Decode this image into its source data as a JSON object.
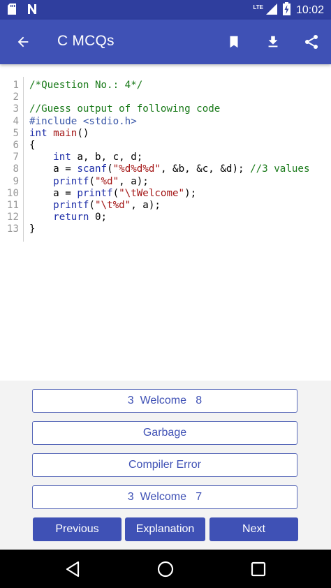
{
  "status_bar": {
    "network": "LTE",
    "time": "10:02",
    "icons": [
      "sd-card-icon",
      "n-logo-icon",
      "signal-icon",
      "battery-charging-icon"
    ]
  },
  "app_bar": {
    "title": "C MCQs",
    "icons": [
      "back-arrow-icon",
      "bookmark-icon",
      "download-icon",
      "share-icon"
    ]
  },
  "code": {
    "line_numbers": [
      "1",
      "2",
      "3",
      "4",
      "5",
      "6",
      "7",
      "8",
      "9",
      "10",
      "11",
      "12",
      "13"
    ],
    "lines": [
      [
        {
          "t": "com",
          "v": "/*Question No.: 4*/"
        }
      ],
      [],
      [
        {
          "t": "com",
          "v": "//Guess output of following code"
        }
      ],
      [
        {
          "t": "pre",
          "v": "#include <stdio.h>"
        }
      ],
      [
        {
          "t": "kw",
          "v": "int"
        },
        {
          "t": "plain",
          "v": " "
        },
        {
          "t": "fn",
          "v": "main"
        },
        {
          "t": "plain",
          "v": "()"
        }
      ],
      [
        {
          "t": "plain",
          "v": "{"
        }
      ],
      [
        {
          "t": "plain",
          "v": "    "
        },
        {
          "t": "kw",
          "v": "int"
        },
        {
          "t": "plain",
          "v": " a, b, c, d;"
        }
      ],
      [
        {
          "t": "plain",
          "v": "    a = "
        },
        {
          "t": "kw",
          "v": "scanf"
        },
        {
          "t": "plain",
          "v": "("
        },
        {
          "t": "str",
          "v": "\"%d%d%d\""
        },
        {
          "t": "plain",
          "v": ", &b, &c, &d); "
        },
        {
          "t": "com",
          "v": "//3 values"
        }
      ],
      [
        {
          "t": "plain",
          "v": "    "
        },
        {
          "t": "kw",
          "v": "printf"
        },
        {
          "t": "plain",
          "v": "("
        },
        {
          "t": "str",
          "v": "\"%d\""
        },
        {
          "t": "plain",
          "v": ", a);"
        }
      ],
      [
        {
          "t": "plain",
          "v": "    a = "
        },
        {
          "t": "kw",
          "v": "printf"
        },
        {
          "t": "plain",
          "v": "("
        },
        {
          "t": "str",
          "v": "\"\\tWelcome\""
        },
        {
          "t": "plain",
          "v": ");"
        }
      ],
      [
        {
          "t": "plain",
          "v": "    "
        },
        {
          "t": "kw",
          "v": "printf"
        },
        {
          "t": "plain",
          "v": "("
        },
        {
          "t": "str",
          "v": "\"\\t%d\""
        },
        {
          "t": "plain",
          "v": ", a);"
        }
      ],
      [
        {
          "t": "plain",
          "v": "    "
        },
        {
          "t": "kw",
          "v": "return"
        },
        {
          "t": "plain",
          "v": " 0;"
        }
      ],
      [
        {
          "t": "plain",
          "v": "}"
        }
      ]
    ]
  },
  "options": [
    {
      "label": "3  Welcome   8"
    },
    {
      "label": "Garbage"
    },
    {
      "label": "Compiler Error"
    },
    {
      "label": "3  Welcome   7"
    }
  ],
  "buttons": {
    "previous": "Previous",
    "explanation": "Explanation",
    "next": "Next"
  },
  "nav_bar": {
    "icons": [
      "back-triangle-icon",
      "home-circle-icon",
      "recents-square-icon"
    ]
  },
  "colors": {
    "status_bar": "#2f3e9e",
    "app_bar": "#3f51b5",
    "accent": "#3f51b5"
  }
}
